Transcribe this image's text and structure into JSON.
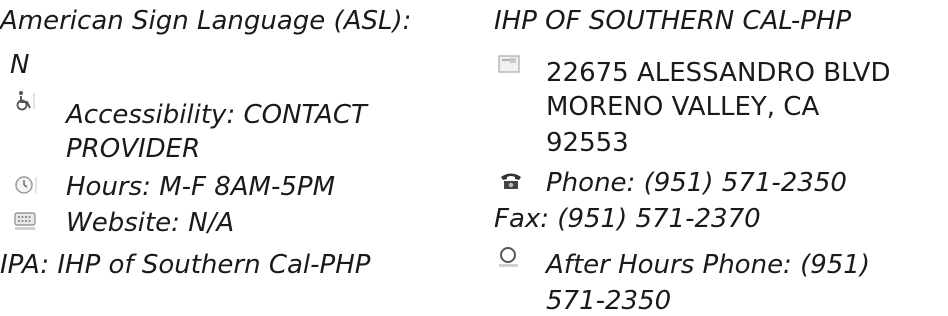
{
  "left": {
    "asl_label": "American Sign Language (ASL):",
    "asl_value": "N",
    "accessibility": {
      "icon": "wheelchair-icon",
      "line1": "Accessibility: CONTACT",
      "line2": "PROVIDER"
    },
    "hours": {
      "icon": "clock-icon",
      "text": "Hours: M-F 8AM-5PM"
    },
    "website": {
      "icon": "keyboard-icon",
      "text": "Website: N/A"
    },
    "ipa": "IPA: IHP of Southern Cal-PHP"
  },
  "right": {
    "provider_name": "IHP OF SOUTHERN CAL-PHP",
    "address": {
      "icon": "map-icon",
      "line1": "22675 ALESSANDRO BLVD",
      "line2": "MORENO VALLEY, CA",
      "line3": "92553"
    },
    "phone": {
      "icon": "telephone-icon",
      "text": "Phone: (951) 571-2350"
    },
    "fax": "Fax: (951) 571-2370",
    "after_hours": {
      "icon": "after-hours-phone-icon",
      "line1": "After Hours Phone: (951)",
      "line2": "571-2350"
    }
  }
}
